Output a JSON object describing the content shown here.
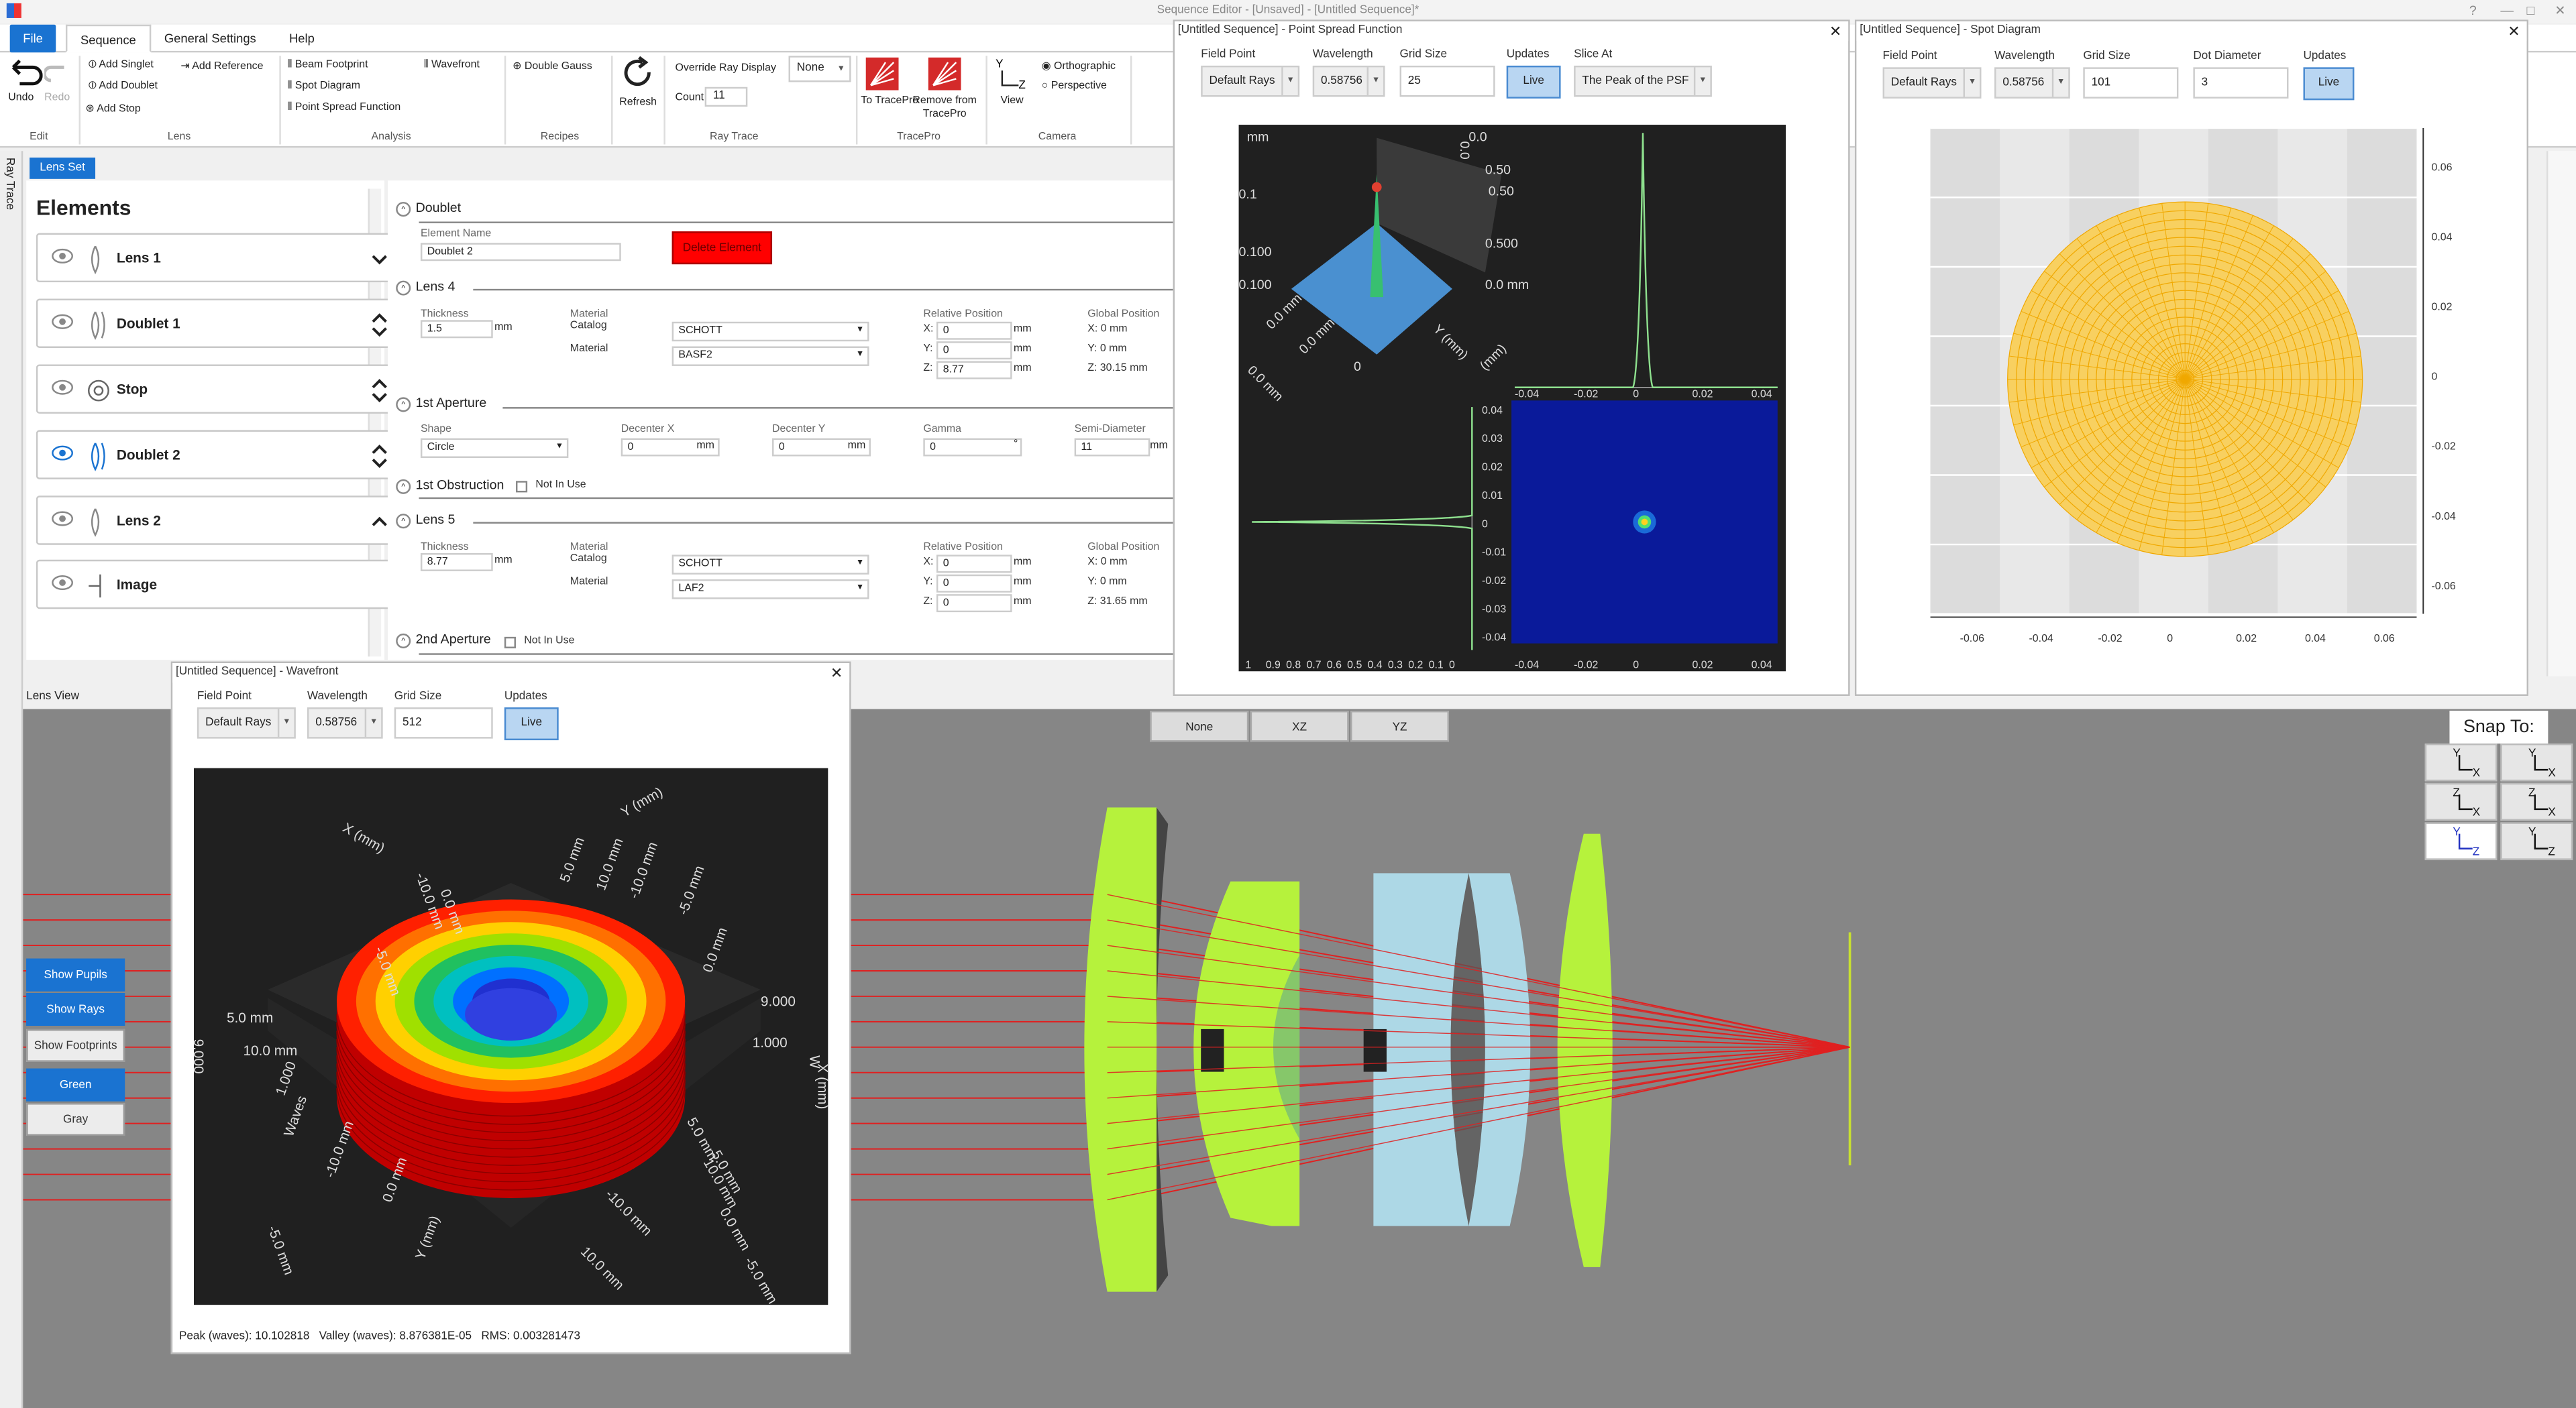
{
  "app": {
    "title": "Sequence Editor - [Unsaved] - [Untitled Sequence]*",
    "controls": [
      "?",
      "—",
      "□",
      "✕"
    ]
  },
  "menu": {
    "file": "File",
    "sequence": "Sequence",
    "general_settings": "General Settings",
    "help": "Help"
  },
  "ribbon": {
    "edit": {
      "undo": "Undo",
      "redo": "Redo",
      "group": "Edit"
    },
    "lens": {
      "add_singlet": "Add Singlet",
      "add_doublet": "Add Doublet",
      "add_stop": "Add Stop",
      "add_reference": "Add Reference",
      "group": "Lens"
    },
    "analysis": {
      "beam_footprint": "Beam Footprint",
      "spot_diagram": "Spot Diagram",
      "psf": "Point Spread Function",
      "wavefront": "Wavefront",
      "group": "Analysis"
    },
    "recipes": {
      "double_gauss": "Double Gauss",
      "group": "Recipes"
    },
    "refresh": "Refresh",
    "raytrace": {
      "override_label": "Override Ray Display",
      "override_value": "None",
      "count_label": "Count",
      "count_value": "11",
      "group": "Ray Trace"
    },
    "tracepro": {
      "to": "To TracePro",
      "remove": "Remove from TracePro",
      "group": "TracePro"
    },
    "camera": {
      "view": "View",
      "orthographic": "Orthographic",
      "perspective": "Perspective",
      "group": "Camera"
    }
  },
  "side_tab": "Ray Trace",
  "lens_set_tab": "Lens Set",
  "elements": {
    "heading": "Elements",
    "items": [
      {
        "label": "Lens 1"
      },
      {
        "label": "Doublet 1"
      },
      {
        "label": "Stop"
      },
      {
        "label": "Doublet 2"
      },
      {
        "label": "Lens 2"
      },
      {
        "label": "Image"
      }
    ]
  },
  "properties": {
    "doublet": {
      "head": "Doublet",
      "name_label": "Element Name",
      "name_value": "Doublet 2",
      "delete": "Delete Element"
    },
    "lens4": {
      "head": "Lens 4",
      "thickness_label": "Thickness",
      "thickness": "1.5",
      "unit": "mm",
      "material_label": "Material",
      "catalog_label": "Catalog",
      "catalog": "SCHOTT",
      "material2_label": "Material",
      "material": "BASF2",
      "relpos_label": "Relative Position",
      "x": "0",
      "y": "0",
      "z": "8.77",
      "globpos_label": "Global Position",
      "gx": "X: 0 mm",
      "gy": "Y: 0 mm",
      "gz": "Z: 30.15 mm"
    },
    "aperture1": {
      "head": "1st Aperture",
      "shape_label": "Shape",
      "shape": "Circle",
      "dx_label": "Decenter X",
      "dx": "0",
      "dy_label": "Decenter Y",
      "dy": "0",
      "gamma_label": "Gamma",
      "gamma": "0",
      "semi_label": "Semi-Diameter",
      "semi": "11",
      "unit": "mm",
      "deg": "°"
    },
    "obstruction1": {
      "head": "1st Obstruction",
      "not_in_use": "Not In Use"
    },
    "lens5": {
      "head": "Lens 5",
      "thickness_label": "Thickness",
      "thickness": "8.77",
      "unit": "mm",
      "material_label": "Material",
      "catalog_label": "Catalog",
      "catalog": "SCHOTT",
      "material2_label": "Material",
      "material": "LAF2",
      "relpos_label": "Relative Position",
      "x": "0",
      "y": "0",
      "z": "0",
      "globpos_label": "Global Position",
      "gx": "X: 0 mm",
      "gy": "Y: 0 mm",
      "gz": "Z: 31.65 mm"
    },
    "aperture2": {
      "head": "2nd Aperture",
      "not_in_use": "Not In Use"
    },
    "xl": "X:",
    "yl": "Y:",
    "zl": "Z:"
  },
  "lens_view": {
    "label": "Lens View",
    "buttons": [
      "None",
      "XZ",
      "YZ"
    ],
    "side_buttons": [
      "Show Pupils",
      "Show Rays",
      "Show Footprints",
      "Green",
      "Gray"
    ],
    "snap_label": "Snap To:"
  },
  "psf_win": {
    "title": "[Untitled Sequence] - Point Spread Function",
    "field_point_label": "Field Point",
    "field_point": "Default Rays",
    "wavelength_label": "Wavelength",
    "wavelength": "0.58756",
    "grid_label": "Grid Size",
    "grid": "25",
    "updates_label": "Updates",
    "live": "Live",
    "slice_label": "Slice At",
    "slice": "The Peak of the PSF",
    "xticks": [
      "-0.04",
      "-0.02",
      "0",
      "0.02",
      "0.04"
    ],
    "yticks": [
      "0.04",
      "0.03",
      "0.02",
      "0.01",
      "0",
      "-0.01",
      "-0.02",
      "-0.03",
      "-0.04"
    ],
    "intensity_ticks": [
      "1",
      "0.9",
      "0.8",
      "0.7",
      "0.6",
      "0.5",
      "0.4",
      "0.3",
      "0.2",
      "0.1",
      "0"
    ],
    "iso_labels": [
      "mm",
      "0.0",
      "0.1",
      "0.50",
      "0.100",
      "0.500",
      "0.100",
      "0.0 mm",
      "0.0 mm",
      "Y (mm)",
      "0.0 mm",
      "(mm)",
      "0",
      "0.50",
      "0.0 mm",
      "0.0"
    ]
  },
  "spot_win": {
    "title": "[Untitled Sequence] - Spot Diagram",
    "field_point_label": "Field Point",
    "field_point": "Default Rays",
    "wavelength_label": "Wavelength",
    "wavelength": "0.58756",
    "grid_label": "Grid Size",
    "grid": "101",
    "dot_label": "Dot Diameter",
    "dot": "3",
    "updates_label": "Updates",
    "live": "Live",
    "xticks": [
      "-0.06",
      "-0.04",
      "-0.02",
      "0",
      "0.02",
      "0.04",
      "0.06"
    ],
    "yticks": [
      "0.06",
      "0.04",
      "0.02",
      "0",
      "-0.02",
      "-0.04",
      "-0.06"
    ]
  },
  "wave_win": {
    "title": "[Untitled Sequence] - Wavefront",
    "field_point_label": "Field Point",
    "field_point": "Default Rays",
    "wavelength_label": "Wavelength",
    "wavelength": "0.58756",
    "grid_label": "Grid Size",
    "grid": "512",
    "updates_label": "Updates",
    "live": "Live",
    "stats": "Peak (waves): 10.102818   Valley (waves): 8.876381E-05   RMS: 0.003281473",
    "iso_labels": [
      "X (mm)",
      "Y (mm)",
      "-10.0 mm",
      "-5.0 mm",
      "0.0 mm",
      "5.0 mm",
      "10.0 mm",
      "-10.0 mm",
      "-5.0 mm",
      "0.0 mm",
      "5.0 mm",
      "10.0 mm",
      "9.000",
      "1.000",
      "9.000",
      "1.000",
      "Waves",
      "-10.0 mm",
      "-5.0 mm",
      "0.0 mm",
      "Y (mm)",
      "5.0 mm",
      "10.0 mm",
      "0.0 mm",
      "-5.0 mm",
      "-10.0 mm",
      "10.0 mm",
      "5.0 mm",
      "X (mm)",
      "W"
    ]
  },
  "colors": {
    "accent": "#1a73d1",
    "lens_green": "#b6f23c",
    "lens_blue": "#add8e6",
    "ray_red": "#e02020",
    "spot": "#f5b800",
    "delete_red": "#ff0000"
  }
}
